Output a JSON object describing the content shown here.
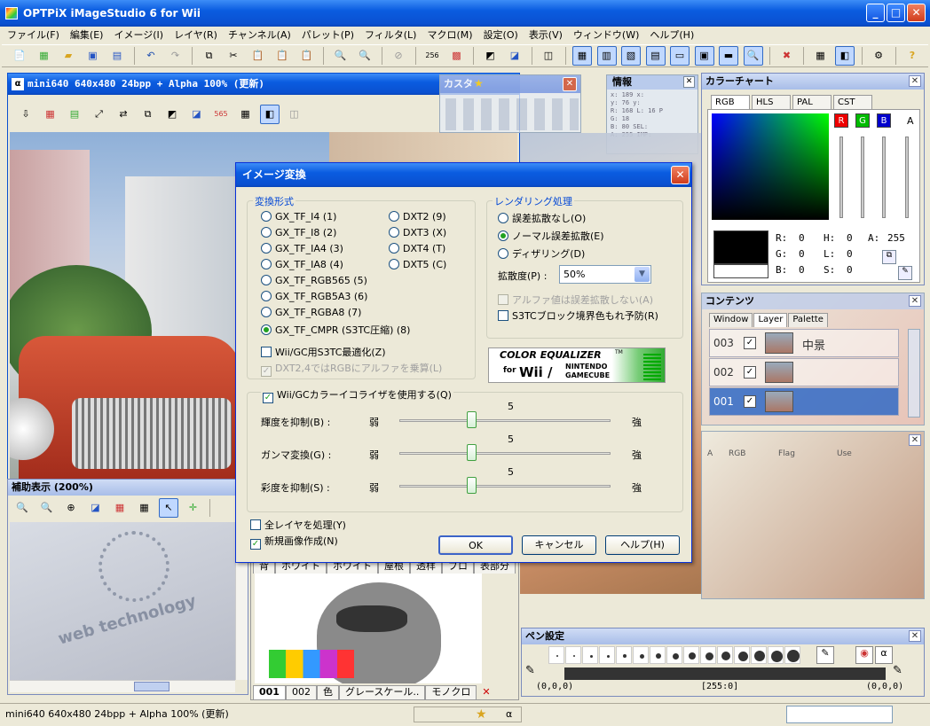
{
  "app": {
    "title": "OPTPiX iMageStudio 6 for Wii",
    "menu": [
      "ファイル(F)",
      "編集(E)",
      "イメージ(I)",
      "レイヤ(R)",
      "チャンネル(A)",
      "パレット(P)",
      "フィルタ(L)",
      "マクロ(M)",
      "設定(O)",
      "表示(V)",
      "ウィンドウ(W)",
      "ヘルプ(H)"
    ]
  },
  "image_window": {
    "title": "mini640  640x480  24bpp + Alpha  100%  (更新)"
  },
  "custom_panel": {
    "title": "カスタ"
  },
  "info_panel": {
    "title": "情報",
    "lines": [
      "x:   189   x:",
      "y:    76   y:",
      "R:   168   L: 16  P",
      "G:    18   ",
      "B:    80   SEL:",
      "A:   255   IMP:"
    ]
  },
  "color_chart": {
    "title": "カラーチャート",
    "tabs": [
      "RGB",
      "HLS",
      "PAL",
      "CST"
    ],
    "channels": [
      "R",
      "G",
      "B"
    ],
    "alpha_label": "A",
    "readout": [
      {
        "k": "R:",
        "v": "0",
        "k2": "H:",
        "v2": "0",
        "k3": "A:",
        "v3": "255"
      },
      {
        "k": "G:",
        "v": "0",
        "k2": "L:",
        "v2": "0",
        "k3": "",
        "v3": ""
      },
      {
        "k": "B:",
        "v": "0",
        "k2": "S:",
        "v2": "0",
        "k3": "",
        "v3": ""
      }
    ]
  },
  "contents_panel": {
    "title": "コンテンツ",
    "tabs": [
      "Window",
      "Layer",
      "Palette"
    ],
    "layers": [
      {
        "id": "003",
        "name": "中景"
      },
      {
        "id": "002",
        "name": ""
      },
      {
        "id": "001",
        "name": ""
      }
    ],
    "columns": [
      "A",
      "RGB",
      "Flag",
      "Use"
    ]
  },
  "aux_window": {
    "title": "補助表示 (200%)",
    "text": "web technology"
  },
  "bottom_tabs": [
    "001",
    "002",
    "色",
    "グレースケール..",
    "モノクロ"
  ],
  "middle_tabs": [
    "背",
    "ホワイト",
    "ホワイト",
    "屋根",
    "透样",
    "ブロ",
    "表部分"
  ],
  "pen_panel": {
    "title": "ペン設定",
    "coords_left": "(0,0,0)",
    "coords_mid": "[255:0]",
    "coords_right": "(0,0,0)"
  },
  "dialog": {
    "title": "イメージ変換",
    "format_group": "変換形式",
    "formats_left": [
      "GX_TF_I4 (1)",
      "GX_TF_I8 (2)",
      "GX_TF_IA4 (3)",
      "GX_TF_IA8 (4)",
      "GX_TF_RGB565 (5)",
      "GX_TF_RGB5A3 (6)",
      "GX_TF_RGBA8 (7)",
      "GX_TF_CMPR (S3TC圧縮) (8)"
    ],
    "formats_right": [
      "DXT2 (9)",
      "DXT3 (X)",
      "DXT4 (T)",
      "DXT5 (C)"
    ],
    "selected_format": "GX_TF_CMPR (S3TC圧縮) (8)",
    "chk_s3tc": "Wii/GC用S3TC最適化(Z)",
    "chk_dxt": "DXT2,4ではRGBにアルファを乗算(L)",
    "render_group": "レンダリング処理",
    "render_options": [
      "誤差拡散なし(O)",
      "ノーマル誤差拡散(E)",
      "ディザリング(D)"
    ],
    "render_selected": "ノーマル誤差拡散(E)",
    "spread_label": "拡散度(P) :",
    "spread_value": "50%",
    "chk_alpha": "アルファ値は誤差拡散しない(A)",
    "chk_s3tc_block": "S3TCブロック境界色もれ予防(R)",
    "eq_logo_line1": "COLOR EQUALIZER",
    "eq_logo_for": "for",
    "eq_logo_wii": "Wii /",
    "eq_logo_tm": "TM",
    "eq_logo_nintendo": "NINTENDO",
    "eq_logo_gc": "GAMECUBE",
    "chk_equalizer": "Wii/GCカラーイコライザを使用する(Q)",
    "sliders": [
      {
        "label": "輝度を抑制(B) :",
        "weak": "弱",
        "strong": "強",
        "value": "5",
        "level": 0.5
      },
      {
        "label": "ガンマ変換(G) :",
        "weak": "弱",
        "strong": "強",
        "value": "5",
        "level": 0.5
      },
      {
        "label": "彩度を抑制(S) :",
        "weak": "弱",
        "strong": "強",
        "value": "5",
        "level": 0.5
      }
    ],
    "chk_all_layers": "全レイヤを処理(Y)",
    "chk_new_image": "新規画像作成(N)",
    "ok": "OK",
    "cancel": "キャンセル",
    "help": "ヘルプ(H)"
  },
  "status_bar": {
    "text": "mini640  640x480  24bpp + Alpha  100%  (更新)"
  }
}
